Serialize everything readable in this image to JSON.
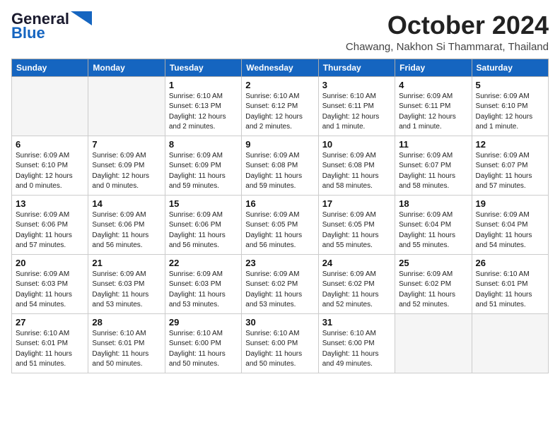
{
  "logo": {
    "general": "General",
    "blue": "Blue"
  },
  "header": {
    "month_year": "October 2024",
    "location": "Chawang, Nakhon Si Thammarat, Thailand"
  },
  "days_of_week": [
    "Sunday",
    "Monday",
    "Tuesday",
    "Wednesday",
    "Thursday",
    "Friday",
    "Saturday"
  ],
  "weeks": [
    [
      {
        "day": "",
        "info": ""
      },
      {
        "day": "",
        "info": ""
      },
      {
        "day": "1",
        "info": "Sunrise: 6:10 AM\nSunset: 6:13 PM\nDaylight: 12 hours and 2 minutes."
      },
      {
        "day": "2",
        "info": "Sunrise: 6:10 AM\nSunset: 6:12 PM\nDaylight: 12 hours and 2 minutes."
      },
      {
        "day": "3",
        "info": "Sunrise: 6:10 AM\nSunset: 6:11 PM\nDaylight: 12 hours and 1 minute."
      },
      {
        "day": "4",
        "info": "Sunrise: 6:09 AM\nSunset: 6:11 PM\nDaylight: 12 hours and 1 minute."
      },
      {
        "day": "5",
        "info": "Sunrise: 6:09 AM\nSunset: 6:10 PM\nDaylight: 12 hours and 1 minute."
      }
    ],
    [
      {
        "day": "6",
        "info": "Sunrise: 6:09 AM\nSunset: 6:10 PM\nDaylight: 12 hours and 0 minutes."
      },
      {
        "day": "7",
        "info": "Sunrise: 6:09 AM\nSunset: 6:09 PM\nDaylight: 12 hours and 0 minutes."
      },
      {
        "day": "8",
        "info": "Sunrise: 6:09 AM\nSunset: 6:09 PM\nDaylight: 11 hours and 59 minutes."
      },
      {
        "day": "9",
        "info": "Sunrise: 6:09 AM\nSunset: 6:08 PM\nDaylight: 11 hours and 59 minutes."
      },
      {
        "day": "10",
        "info": "Sunrise: 6:09 AM\nSunset: 6:08 PM\nDaylight: 11 hours and 58 minutes."
      },
      {
        "day": "11",
        "info": "Sunrise: 6:09 AM\nSunset: 6:07 PM\nDaylight: 11 hours and 58 minutes."
      },
      {
        "day": "12",
        "info": "Sunrise: 6:09 AM\nSunset: 6:07 PM\nDaylight: 11 hours and 57 minutes."
      }
    ],
    [
      {
        "day": "13",
        "info": "Sunrise: 6:09 AM\nSunset: 6:06 PM\nDaylight: 11 hours and 57 minutes."
      },
      {
        "day": "14",
        "info": "Sunrise: 6:09 AM\nSunset: 6:06 PM\nDaylight: 11 hours and 56 minutes."
      },
      {
        "day": "15",
        "info": "Sunrise: 6:09 AM\nSunset: 6:06 PM\nDaylight: 11 hours and 56 minutes."
      },
      {
        "day": "16",
        "info": "Sunrise: 6:09 AM\nSunset: 6:05 PM\nDaylight: 11 hours and 56 minutes."
      },
      {
        "day": "17",
        "info": "Sunrise: 6:09 AM\nSunset: 6:05 PM\nDaylight: 11 hours and 55 minutes."
      },
      {
        "day": "18",
        "info": "Sunrise: 6:09 AM\nSunset: 6:04 PM\nDaylight: 11 hours and 55 minutes."
      },
      {
        "day": "19",
        "info": "Sunrise: 6:09 AM\nSunset: 6:04 PM\nDaylight: 11 hours and 54 minutes."
      }
    ],
    [
      {
        "day": "20",
        "info": "Sunrise: 6:09 AM\nSunset: 6:03 PM\nDaylight: 11 hours and 54 minutes."
      },
      {
        "day": "21",
        "info": "Sunrise: 6:09 AM\nSunset: 6:03 PM\nDaylight: 11 hours and 53 minutes."
      },
      {
        "day": "22",
        "info": "Sunrise: 6:09 AM\nSunset: 6:03 PM\nDaylight: 11 hours and 53 minutes."
      },
      {
        "day": "23",
        "info": "Sunrise: 6:09 AM\nSunset: 6:02 PM\nDaylight: 11 hours and 53 minutes."
      },
      {
        "day": "24",
        "info": "Sunrise: 6:09 AM\nSunset: 6:02 PM\nDaylight: 11 hours and 52 minutes."
      },
      {
        "day": "25",
        "info": "Sunrise: 6:09 AM\nSunset: 6:02 PM\nDaylight: 11 hours and 52 minutes."
      },
      {
        "day": "26",
        "info": "Sunrise: 6:10 AM\nSunset: 6:01 PM\nDaylight: 11 hours and 51 minutes."
      }
    ],
    [
      {
        "day": "27",
        "info": "Sunrise: 6:10 AM\nSunset: 6:01 PM\nDaylight: 11 hours and 51 minutes."
      },
      {
        "day": "28",
        "info": "Sunrise: 6:10 AM\nSunset: 6:01 PM\nDaylight: 11 hours and 50 minutes."
      },
      {
        "day": "29",
        "info": "Sunrise: 6:10 AM\nSunset: 6:00 PM\nDaylight: 11 hours and 50 minutes."
      },
      {
        "day": "30",
        "info": "Sunrise: 6:10 AM\nSunset: 6:00 PM\nDaylight: 11 hours and 50 minutes."
      },
      {
        "day": "31",
        "info": "Sunrise: 6:10 AM\nSunset: 6:00 PM\nDaylight: 11 hours and 49 minutes."
      },
      {
        "day": "",
        "info": ""
      },
      {
        "day": "",
        "info": ""
      }
    ]
  ]
}
